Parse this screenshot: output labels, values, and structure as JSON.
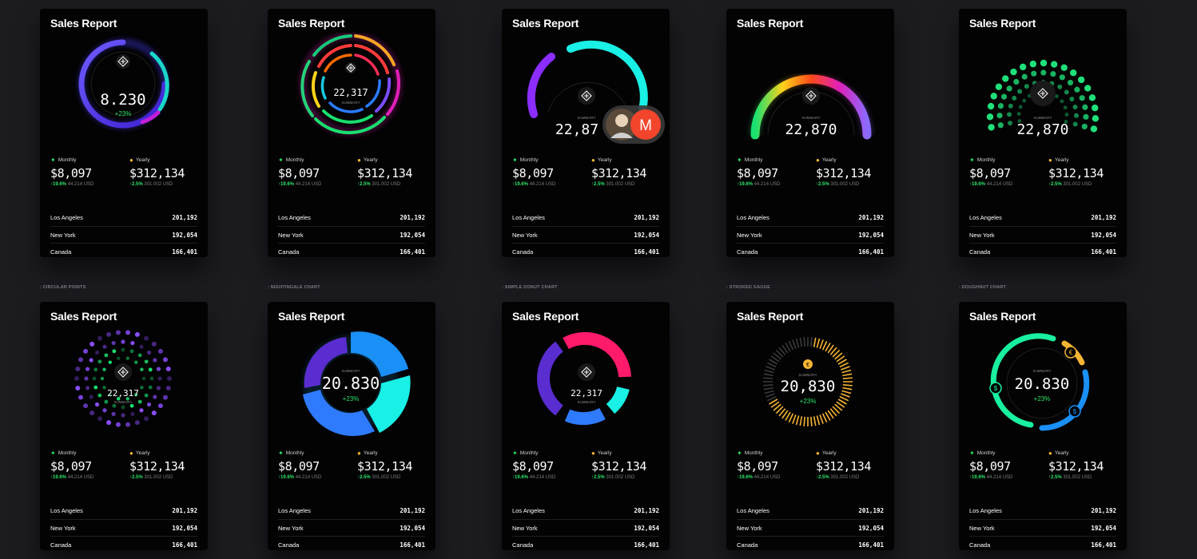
{
  "card_title": "Sales Report",
  "monthly": {
    "label": "Monthly",
    "value": "$8,097",
    "change": "↑19.6%",
    "sub": "44.214 USD"
  },
  "yearly": {
    "label": "Yearly",
    "value": "$312,134",
    "change": "↑2.5%",
    "sub": "301.002 USD"
  },
  "cities": [
    {
      "name": "Los Angeles",
      "value": "201,192"
    },
    {
      "name": "New York",
      "value": "192,054"
    },
    {
      "name": "Canada",
      "value": "166,401"
    }
  ],
  "summary_label": "SUMMARY",
  "values": {
    "v8230": "8.230",
    "v22317": "22,317",
    "v22870": "22,870",
    "v22870_partial": "22,87",
    "v20830": "20.830",
    "v20830c": "20,830",
    "pct": "+23%"
  },
  "section_labels": {
    "circular_points": ": CIRCULAR POINTS",
    "nightingale": ": NIGHTINGALE CHART",
    "simple_donut": ": SIMPLE DONUT CHART",
    "stroked_gauge": ": STROKED GAUGE",
    "doughnut": ": DOUGHNUT CHART"
  },
  "avatar_initial": "M",
  "badge_icons": [
    "euro-coin-icon",
    "dollar-coin-icon"
  ],
  "colors": {
    "bg": "#1c1b20",
    "card": "#030303",
    "up": "#2ee66b",
    "accent_cyan": "#19f0e6",
    "accent_purple": "#8b4dff"
  }
}
